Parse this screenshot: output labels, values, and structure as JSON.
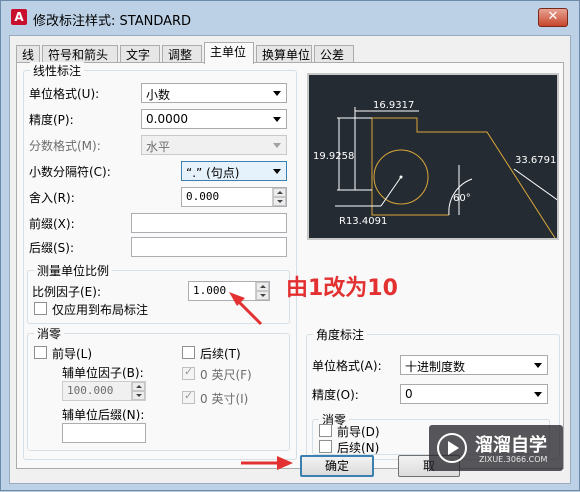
{
  "window": {
    "title": "修改标注样式: STANDARD",
    "app_icon": "A",
    "close_glyph": "✕"
  },
  "tabs": [
    {
      "label": "线"
    },
    {
      "label": "符号和箭头"
    },
    {
      "label": "文字"
    },
    {
      "label": "调整"
    },
    {
      "label": "主单位",
      "active": true
    },
    {
      "label": "换算单位"
    },
    {
      "label": "公差"
    }
  ],
  "linear": {
    "title": "线性标注",
    "unit_format_label": "单位格式(U):",
    "unit_format_value": "小数",
    "precision_label": "精度(P):",
    "precision_value": "0.0000",
    "fraction_format_label": "分数格式(M):",
    "fraction_format_value": "水平",
    "decimal_sep_label": "小数分隔符(C):",
    "decimal_sep_value": "“.” (句点)",
    "round_label": "舍入(R):",
    "round_value": "0.000",
    "prefix_label": "前缀(X):",
    "suffix_label": "后缀(S):"
  },
  "scale": {
    "title": "测量单位比例",
    "factor_label": "比例因子(E):",
    "factor_value": "1.000",
    "layout_only_label": "仅应用到布局标注"
  },
  "zero_left": {
    "title": "消零",
    "leading_label": "前导(L)",
    "sub_factor_label": "辅单位因子(B):",
    "sub_factor_value": "100.000",
    "sub_suffix_label": "辅单位后缀(N):",
    "trailing_label": "后续(T)",
    "feet_label": "0 英尺(F)",
    "inches_label": "0 英寸(I)"
  },
  "angular": {
    "title": "角度标注",
    "unit_format_label": "单位格式(A):",
    "unit_format_value": "十进制度数",
    "precision_label": "精度(O):",
    "precision_value": "0",
    "zero": {
      "title": "消零",
      "leading_label": "前导(D)",
      "trailing_label": "后续(N)"
    }
  },
  "preview": {
    "dim_top": "16.9317",
    "dim_left": "19.9258",
    "dim_right": "33.6791",
    "dim_angle": "60°",
    "dim_radius": "R13.4091",
    "line_color": "#d9a63a",
    "text_color": "#ffffff"
  },
  "annotation": {
    "text": "由1改为10",
    "color": "#e33030"
  },
  "buttons": {
    "ok": "确定",
    "cancel": "取"
  },
  "watermark": {
    "name": "溜溜自学",
    "url": "ZIXUE.3066.COM"
  }
}
